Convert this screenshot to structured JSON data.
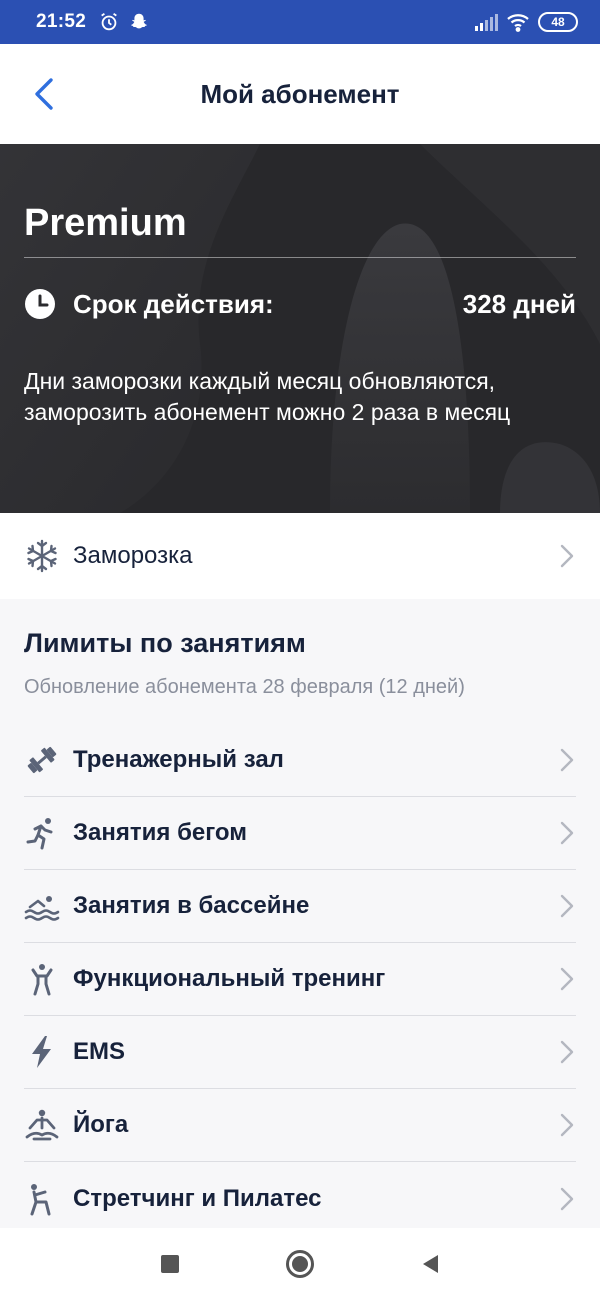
{
  "status_bar": {
    "time": "21:52",
    "battery": "48"
  },
  "header": {
    "title": "Мой абонемент",
    "back_icon": "chevron-left-icon"
  },
  "plan": {
    "name": "Premium",
    "validity_label": "Срок действия:",
    "validity_value": "328 дней",
    "freeze_note": "Дни заморозки каждый месяц обновляются, заморозить абонемент можно 2 раза в месяц"
  },
  "freeze": {
    "label": "Заморозка",
    "icon": "snowflake-icon"
  },
  "limits": {
    "title": "Лимиты по занятиям",
    "subtitle": "Обновление абонемента 28 февраля (12 дней)",
    "items": [
      {
        "label": "Тренажерный зал",
        "icon": "dumbbell-icon"
      },
      {
        "label": "Занятия бегом",
        "icon": "runner-icon"
      },
      {
        "label": "Занятия в бассейне",
        "icon": "swimmer-icon"
      },
      {
        "label": "Функциональный тренинг",
        "icon": "functional-training-icon"
      },
      {
        "label": "EMS",
        "icon": "lightning-icon"
      },
      {
        "label": "Йога",
        "icon": "yoga-icon"
      },
      {
        "label": "Стретчинг и Пилатес",
        "icon": "stretching-icon"
      }
    ]
  },
  "colors": {
    "status_bar": "#2b50b3",
    "accent": "#2f6fde",
    "text": "#17223b",
    "hero_bg": "#2a2a2d"
  }
}
